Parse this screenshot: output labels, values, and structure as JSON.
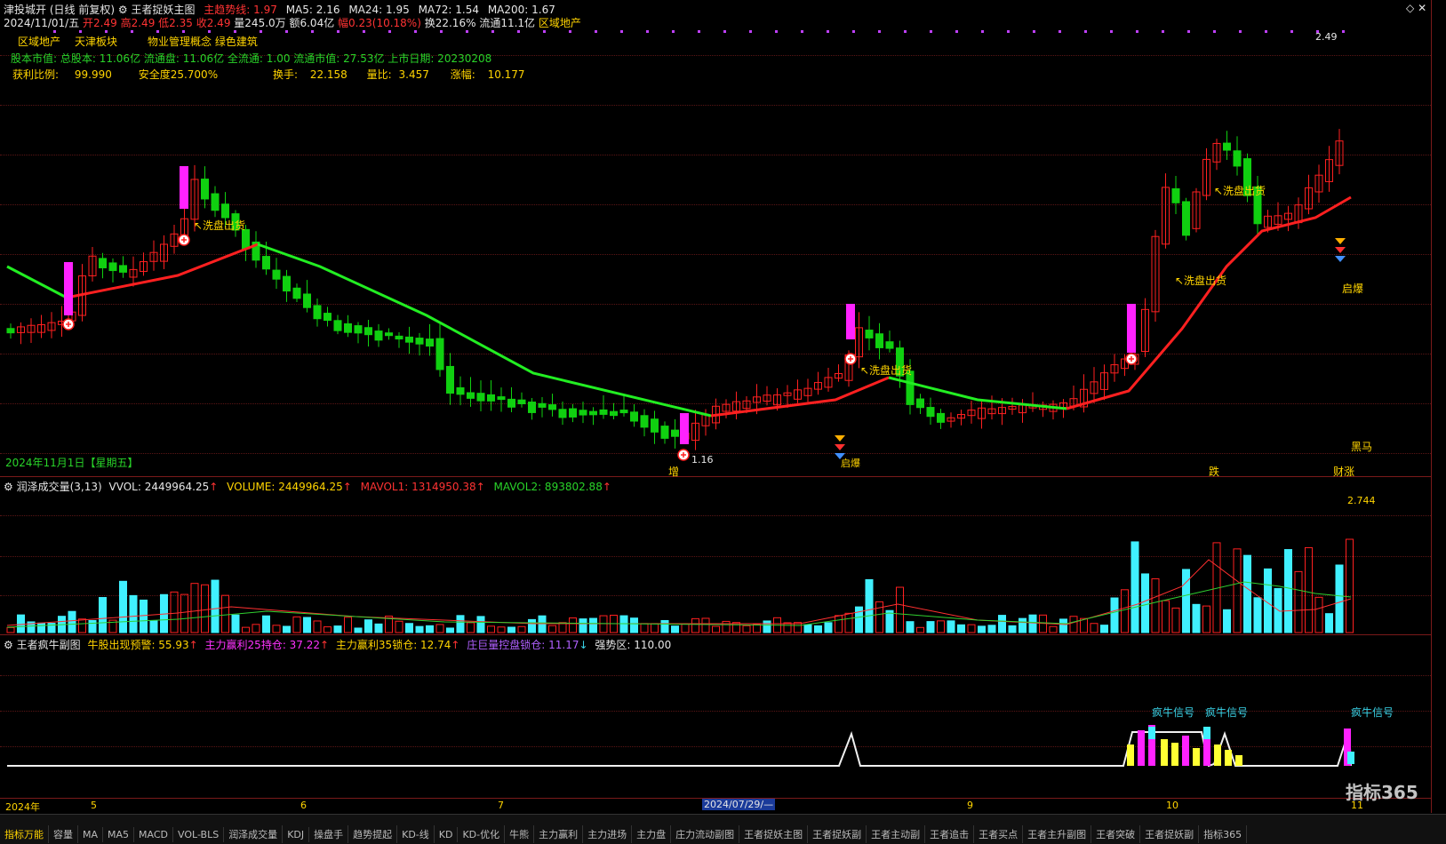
{
  "header": {
    "stock_name": "津投城开",
    "period": "(日线 前复权)",
    "indicator_name": "王者捉妖主图",
    "trend_label": "主趋势线: 1.97",
    "ma5": "MA5: 2.16",
    "ma24": "MA24: 1.95",
    "ma72": "MA72: 1.54",
    "ma200": "MA200: 1.67"
  },
  "quote_line": {
    "date": "2024/11/01/五",
    "open": "开2.49",
    "high": "高2.49",
    "low": "低2.35",
    "close": "收2.49",
    "volume": "量245.0万",
    "amount": "额6.04亿",
    "change": "幅0.23(10.18%)",
    "turnover": "换22.16%",
    "float": "流通11.1亿",
    "sector": "区域地产"
  },
  "concepts": {
    "c1": "区域地产",
    "c2": "天津板块",
    "c3": "物业管理概念 绿色建筑"
  },
  "info_line": {
    "text": "股本市值: 总股本: 11.06亿 流通盘: 11.06亿 全流通: 1.00 流通市值: 27.53亿 上市日期: 20230208"
  },
  "stats_line": {
    "profit_ratio_label": "获利比例:",
    "profit_ratio": "99.990",
    "safety": "安全度25.700%",
    "turnover_label": "换手:",
    "turnover": "22.158",
    "vol_ratio_label": "量比:",
    "vol_ratio": "3.457",
    "change_label": "涨幅:",
    "change": "10.177"
  },
  "main_chart": {
    "date_footer": "2024年11月1日【星期五】",
    "high_label": "2.49",
    "low_label": "1.16",
    "annotations": {
      "wash1": "↖洗盘出货",
      "wash2": "↖洗盘出货",
      "wash3": "↖洗盘出货",
      "wash4": "↖洗盘出货",
      "qibao1": "启爆",
      "qibao2": "启爆",
      "heima": "黑马",
      "zeng": "增",
      "die": "跌",
      "caizhang": "财涨"
    }
  },
  "volume_pane": {
    "title": "润泽成交量(3,13)",
    "vvol": "VVOL: 2449964.25",
    "volume": "VOLUME: 2449964.25",
    "mavol1": "MAVOL1: 1314950.38",
    "mavol2": "MAVOL2: 893802.88",
    "max_label": "2.744"
  },
  "sub_pane": {
    "title": "王者疯牛副图",
    "warn": "牛股出现预警: 55.93",
    "hold25": "主力赢利25持仓: 37.22",
    "lock35": "主力赢利35锁仓: 12.74",
    "lock_big": "庄巨量控盘锁仓: 11.17",
    "strong": "强势区: 110.00",
    "signal1": "疯牛信号",
    "signal2": "疯牛信号",
    "signal3": "疯牛信号"
  },
  "time_axis": {
    "t1": "2024年",
    "t2": "5",
    "t3": "6",
    "t4": "7",
    "t5": "2024/07/29/—",
    "t6": "9",
    "t7": "10",
    "t8": "11"
  },
  "watermark": "指标365",
  "chart_data": {
    "type": "candlestick",
    "title": "王者捉妖主图",
    "series": [
      {
        "name": "主趋势线",
        "values": [
          1.97
        ]
      },
      {
        "name": "MA5",
        "values": [
          2.16
        ]
      },
      {
        "name": "MA24",
        "values": [
          1.95
        ]
      },
      {
        "name": "MA72",
        "values": [
          1.54
        ]
      },
      {
        "name": "MA200",
        "values": [
          1.67
        ]
      }
    ],
    "last_bar": {
      "open": 2.49,
      "high": 2.49,
      "low": 2.35,
      "close": 2.49
    },
    "ylim": [
      1.16,
      2.49
    ]
  },
  "colors": {
    "up": "#ff2020",
    "down": "#10d010",
    "trend_up": "#ff2020",
    "trend_down": "#22ee22",
    "vol_bar": "#40f0ff",
    "signal": "#ff22ff"
  },
  "tabs": [
    "指标万能",
    "容量",
    "MA",
    "MA5",
    "MACD",
    "VOL-BLS",
    "润泽成交量",
    "KDJ",
    "操盘手",
    "趋势提起",
    "KD-线",
    "KD",
    "KD-优化",
    "牛熊",
    "主力赢利",
    "主力进场",
    "主力盘",
    "庄力流动副图",
    "王者捉妖主图",
    "王者捉妖副",
    "王者主动副",
    "王者追击",
    "王者买点",
    "王者主升副图",
    "王者突破",
    "王者捉妖副",
    "指标365"
  ]
}
